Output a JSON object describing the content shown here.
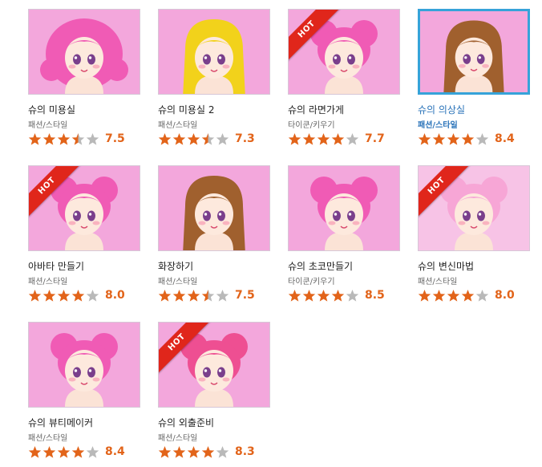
{
  "games": [
    {
      "title": "슈의 미용실",
      "category": "패션/스타일",
      "rating": "7.5",
      "stars": 3.5,
      "hot": false,
      "selected": false,
      "hair": "#f05bb5",
      "bg": "#f3a7dc",
      "hair_style": "wide",
      "icon": "girl-portrait-icon"
    },
    {
      "title": "슈의 미용실 2",
      "category": "패션/스타일",
      "rating": "7.3",
      "stars": 3.5,
      "hot": false,
      "selected": false,
      "hair": "#f2d21b",
      "bg": "#f3a7dc",
      "hair_style": "long",
      "icon": "blonde-girl-icon"
    },
    {
      "title": "슈의 라면가게",
      "category": "타이쿤/키우기",
      "rating": "7.7",
      "stars": 4,
      "hot": true,
      "selected": false,
      "hair": "#f05bb5",
      "bg": "#f3a7dc",
      "hair_style": "buns",
      "icon": "ramen-chef-icon"
    },
    {
      "title": "슈의 의상실",
      "category": "패션/스타일",
      "rating": "8.4",
      "stars": 4,
      "hot": false,
      "selected": true,
      "hair": "#a0602e",
      "bg": "#f3a7dc",
      "hair_style": "long",
      "icon": "dress-shop-icon"
    },
    {
      "title": "아바타 만들기",
      "category": "패션/스타일",
      "rating": "8.0",
      "stars": 4,
      "hot": true,
      "selected": false,
      "hair": "#f05bb5",
      "bg": "#f3a7dc",
      "hair_style": "buns",
      "icon": "avatar-girl-icon"
    },
    {
      "title": "화장하기",
      "category": "패션/스타일",
      "rating": "7.5",
      "stars": 3.5,
      "hot": false,
      "selected": false,
      "hair": "#a0602e",
      "bg": "#f3a7dc",
      "hair_style": "long",
      "icon": "makeup-girl-icon"
    },
    {
      "title": "슈의 초코만들기",
      "category": "타이쿤/키우기",
      "rating": "8.5",
      "stars": 4,
      "hot": false,
      "selected": false,
      "hair": "#f05bb5",
      "bg": "#f3a7dc",
      "hair_style": "buns",
      "icon": "chocolate-girl-icon"
    },
    {
      "title": "슈의 변신마법",
      "category": "패션/스타일",
      "rating": "8.0",
      "stars": 4,
      "hot": true,
      "selected": false,
      "hair": "#f7a6d6",
      "bg": "#f7c3e6",
      "hair_style": "buns",
      "icon": "magic-girl-icon"
    },
    {
      "title": "슈의 뷰티메이커",
      "category": "패션/스타일",
      "rating": "8.4",
      "stars": 4,
      "hot": false,
      "selected": false,
      "hair": "#f05bb5",
      "bg": "#f3a7dc",
      "hair_style": "buns",
      "icon": "beauty-girl-icon"
    },
    {
      "title": "슈의 외출준비",
      "category": "패션/스타일",
      "rating": "8.3",
      "stars": 4,
      "hot": true,
      "selected": false,
      "hair": "#ee4f92",
      "bg": "#f3a7dc",
      "hair_style": "buns",
      "icon": "clock-girl-icon"
    }
  ],
  "hot_label": "HOT",
  "colors": {
    "star_filled": "#e2641a",
    "star_empty": "#b9b9b9",
    "score": "#e2641a",
    "selected_border": "#36a3d9",
    "selected_text": "#2a73b9"
  }
}
